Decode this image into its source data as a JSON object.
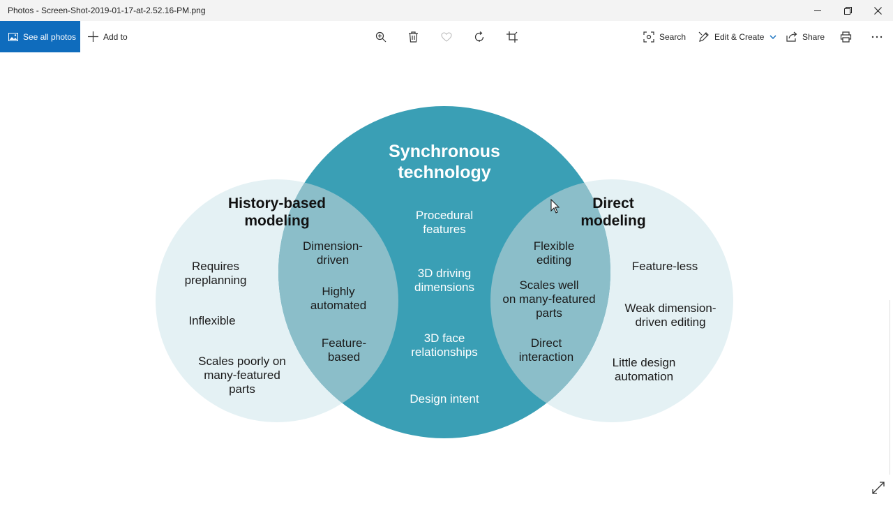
{
  "window": {
    "title": "Photos - Screen-Shot-2019-01-17-at-2.52.16-PM.png",
    "controls": [
      "minimize-icon",
      "restore-icon",
      "close-icon"
    ]
  },
  "toolbar": {
    "see_all_label": "See all photos",
    "add_to_label": "Add to",
    "search_label": "Search",
    "edit_create_label": "Edit & Create",
    "share_label": "Share",
    "center_icons": [
      "zoom-icon",
      "delete-icon",
      "heart-icon",
      "rotate-icon",
      "crop-icon"
    ],
    "accent": "#0f6cbd"
  },
  "diagram": {
    "colors": {
      "center": "#3a9fb5",
      "side": "#e4f1f4",
      "overlap": "#8bbec9"
    },
    "center": {
      "title_lines": [
        "Synchronous",
        "technology"
      ],
      "items": [
        [
          "Procedural",
          "features"
        ],
        [
          "3D driving",
          "dimensions"
        ],
        [
          "3D face",
          "relationships"
        ],
        [
          "Design intent"
        ]
      ]
    },
    "left": {
      "title_lines": [
        "History-based",
        "modeling"
      ],
      "items": [
        [
          "Requires",
          "preplanning"
        ],
        [
          "Inflexible"
        ],
        [
          "Scales poorly on",
          "many-featured",
          "parts"
        ]
      ]
    },
    "right": {
      "title_lines": [
        "Direct",
        "modeling"
      ],
      "items": [
        [
          "Feature-less"
        ],
        [
          "Weak dimension-",
          "driven editing"
        ],
        [
          "Little design",
          "automation"
        ]
      ]
    },
    "left_overlap": {
      "items": [
        [
          "Dimension-",
          "driven"
        ],
        [
          "Highly",
          "automated"
        ],
        [
          "Feature-",
          "based"
        ]
      ]
    },
    "right_overlap": {
      "items": [
        [
          "Flexible",
          "editing"
        ],
        [
          "Scales well",
          "on many-featured",
          "parts"
        ],
        [
          "Direct",
          "interaction"
        ]
      ]
    }
  }
}
